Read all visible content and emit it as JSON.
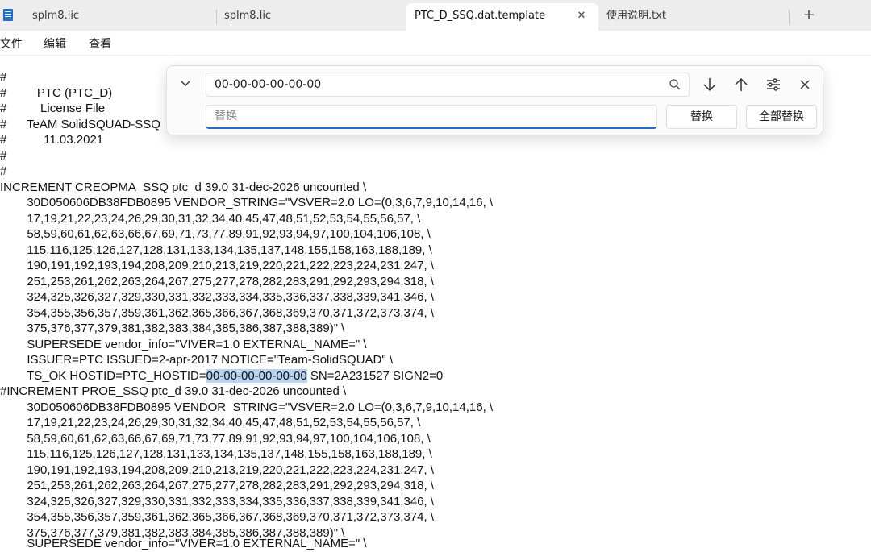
{
  "tabs": [
    {
      "label": "splm8.lic"
    },
    {
      "label": "splm8.lic"
    },
    {
      "label": "PTC_D_SSQ.dat.template"
    },
    {
      "label": "使用说明.txt"
    }
  ],
  "tab_close_glyph": "✕",
  "new_tab_glyph": "+",
  "menu": [
    "文件",
    "编辑",
    "查看"
  ],
  "find": {
    "search_value": "00-00-00-00-00-00",
    "replace_placeholder": "替换",
    "replace_button": "替换",
    "replace_all_button": "全部替换"
  },
  "editor_lines": [
    "#",
    "#         PTC (PTC_D)",
    "#          License File",
    "#      TeAM SolidSQUAD-SSQ",
    "#           11.03.2021",
    "#",
    "#",
    "INCREMENT CREOPMA_SSQ ptc_d 39.0 31-dec-2026 uncounted \\",
    "        30D050606DB38FDB0895 VENDOR_STRING=\"VSVER=2.0 LO=(0,3,6,7,9,10,14,16, \\",
    "        17,19,21,22,23,24,26,29,30,31,32,34,40,45,47,48,51,52,53,54,55,56,57, \\",
    "        58,59,60,61,62,63,66,67,69,71,73,77,89,91,92,93,94,97,100,104,106,108, \\",
    "        115,116,125,126,127,128,131,133,134,135,137,148,155,158,163,188,189, \\",
    "        190,191,192,193,194,208,209,210,213,219,220,221,222,223,224,231,247, \\",
    "        251,253,261,262,263,264,267,275,277,278,282,283,291,292,293,294,318, \\",
    "        324,325,326,327,329,330,331,332,333,334,335,336,337,338,339,341,346, \\",
    "        354,355,356,357,359,361,362,365,366,367,368,369,370,371,372,373,374, \\",
    "        375,376,377,379,381,382,383,384,385,386,387,388,389)\" \\",
    "        SUPERSEDE vendor_info=\"VIVER=1.0 EXTERNAL_NAME=\" \\",
    "        ISSUER=PTC ISSUED=2-apr-2017 NOTICE=\"Team-SolidSQUAD\" \\",
    "        TS_OK HOSTID=PTC_HOSTID=",
    "#INCREMENT PROE_SSQ ptc_d 39.0 31-dec-2026 uncounted \\",
    "        30D050606DB38FDB0895 VENDOR_STRING=\"VSVER=2.0 LO=(0,3,6,7,9,10,14,16, \\",
    "        17,19,21,22,23,24,26,29,30,31,32,34,40,45,47,48,51,52,53,54,55,56,57, \\",
    "        58,59,60,61,62,63,66,67,69,71,73,77,89,91,92,93,94,97,100,104,106,108, \\",
    "        115,116,125,126,127,128,131,133,134,135,137,148,155,158,163,188,189, \\",
    "        190,191,192,193,194,208,209,210,213,219,220,221,222,223,224,231,247, \\",
    "        251,253,261,262,263,264,267,275,277,278,282,283,291,292,293,294,318, \\",
    "        324,325,326,327,329,330,331,332,333,334,335,336,337,338,339,341,346, \\",
    "        354,355,356,357,359,361,362,365,366,367,368,369,370,371,372,373,374, \\",
    "        375,376,377,379,381,382,383,384,385,386,387,388,389)\" \\",
    "        SUPERSEDE vendor_info=\"VIVER=1.0 EXTERNAL_NAME=\" \\"
  ],
  "hostid_match": "00-00-00-00-00-00",
  "hostid_tail": " SN=2A231527 SIGN2=0",
  "colors": {
    "tabbar_bg": "#ededed",
    "selection_highlight": "#b9d3f0",
    "accent": "#1f6fc5"
  }
}
